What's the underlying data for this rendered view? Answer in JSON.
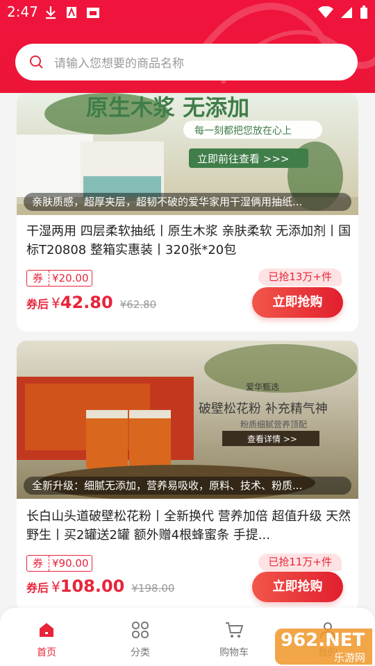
{
  "status_bar": {
    "time": "2:47"
  },
  "search": {
    "placeholder": "请输入您想要的商品名称"
  },
  "products": [
    {
      "banner_headline": "原生木浆 无添加",
      "banner_tagline": "每一刻都把您放在心上",
      "banner_cta": "立即前往查看 >>>",
      "caption": "亲肤质感，超厚夹层，超韧不破的爱华家用干湿俩用抽纸...",
      "title": "干湿两用 四层柔软抽纸丨原生木浆 亲肤柔软 无添加剂丨国标T20808 整箱实惠装丨320张*20包",
      "coupon_label": "券",
      "coupon_value": "¥20.00",
      "price_label": "券后",
      "currency": "¥",
      "price": "42.80",
      "original_price": "¥62.80",
      "sold": "已抢13万+件",
      "buy_label": "立即抢购"
    },
    {
      "banner_brand": "爱华甄选",
      "banner_headline": "破壁松花粉 补充精气神",
      "banner_sub": "粉质细腻营养顶配",
      "banner_cta": "查看详情 >>",
      "caption": "全新升级：细腻无添加，营养易吸收，原料、技术、粉质...",
      "title": "长白山头道破壁松花粉丨全新换代 营养加倍 超值升级 天然野生丨买2罐送2罐 额外赠4根蜂蜜条 手提...",
      "coupon_label": "券",
      "coupon_value": "¥90.00",
      "price_label": "券后",
      "currency": "¥",
      "price": "108.00",
      "original_price": "¥198.00",
      "sold": "已抢11万+件",
      "buy_label": "立即抢购"
    }
  ],
  "tabs": [
    {
      "label": "首页",
      "icon": "home-icon",
      "active": true
    },
    {
      "label": "分类",
      "icon": "grid-icon",
      "active": false
    },
    {
      "label": "购物车",
      "icon": "cart-icon",
      "active": false
    },
    {
      "label": "我的",
      "icon": "user-icon",
      "active": false
    }
  ],
  "watermark": {
    "text": "962.NET",
    "sub": "乐游网"
  },
  "colors": {
    "brand_red": "#ec1538",
    "price_red": "#e8243a"
  }
}
